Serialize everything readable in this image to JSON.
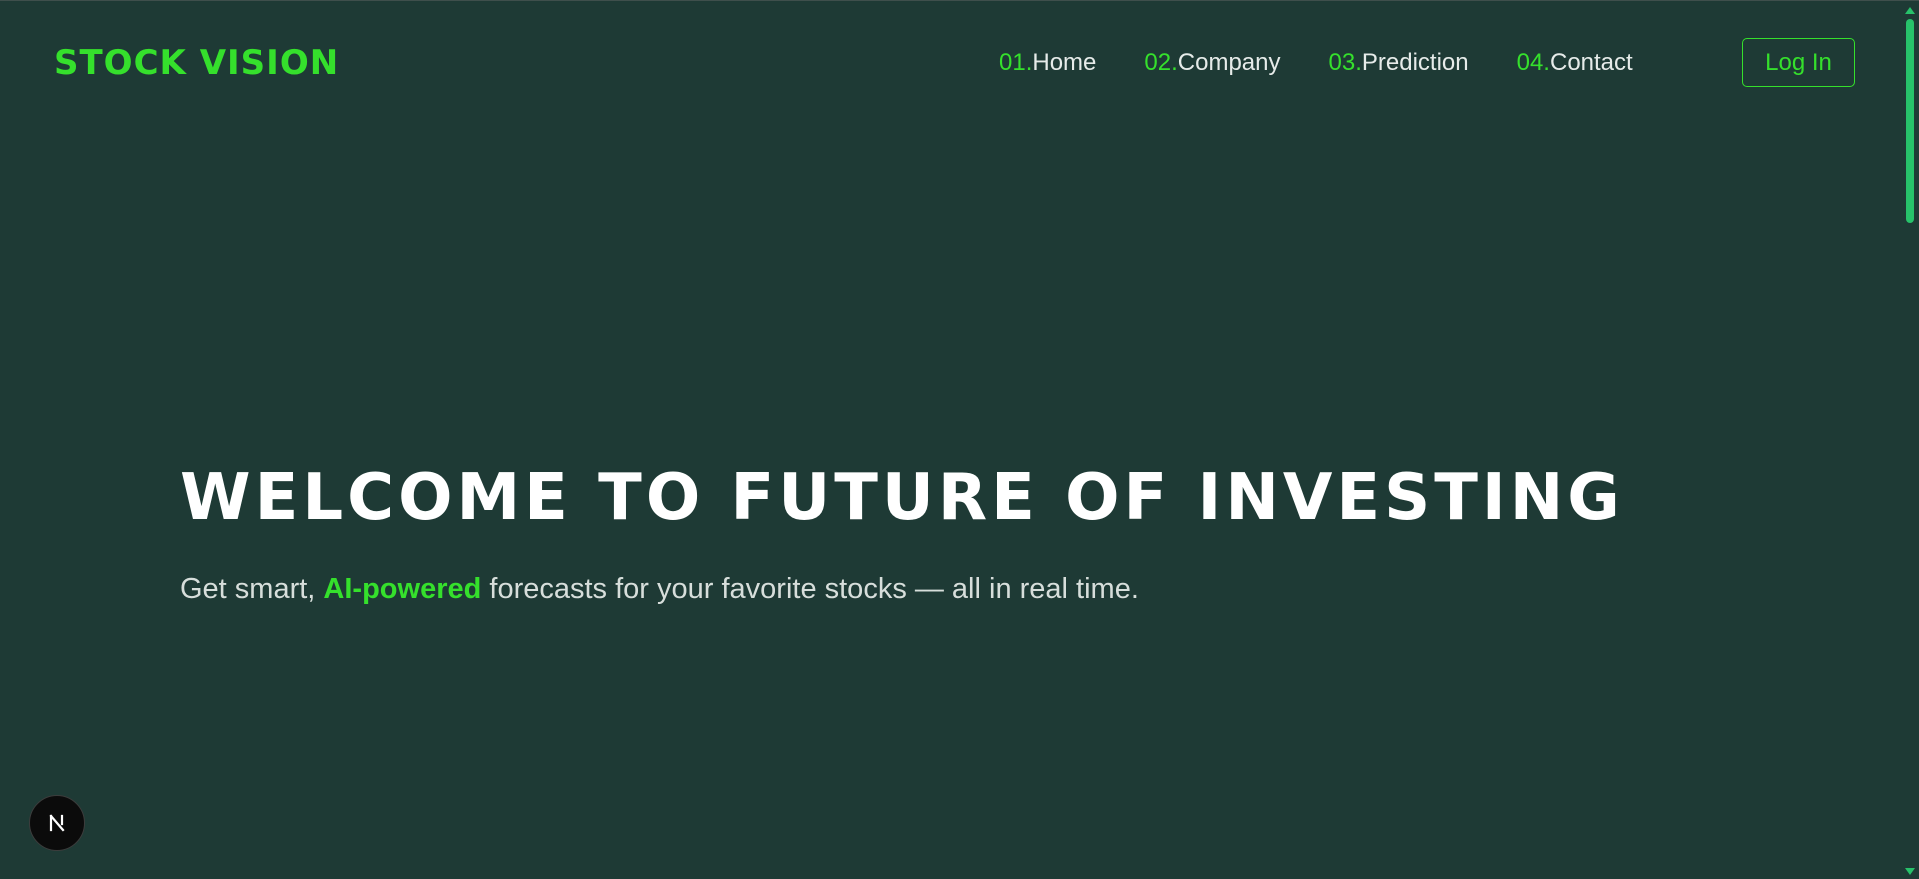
{
  "header": {
    "logo": "STOCK VISION",
    "nav": [
      {
        "num": "01.",
        "label": "Home"
      },
      {
        "num": "02.",
        "label": "Company"
      },
      {
        "num": "03.",
        "label": "Prediction"
      },
      {
        "num": "04.",
        "label": "Contact"
      }
    ],
    "login_label": "Log In"
  },
  "hero": {
    "title": "WELCOME TO FUTURE OF INVESTING",
    "subtitle_before": "Get smart, ",
    "subtitle_accent": "AI-powered",
    "subtitle_after": " forecasts for your favorite stocks — all in real time."
  },
  "dev_badge": {
    "letter": "N",
    "icon": "nextjs-icon"
  },
  "colors": {
    "background": "#1e3a35",
    "accent": "#35e02c",
    "text": "#e6ebe9",
    "heading": "#ffffff",
    "scrollbar": "#27c26a"
  }
}
